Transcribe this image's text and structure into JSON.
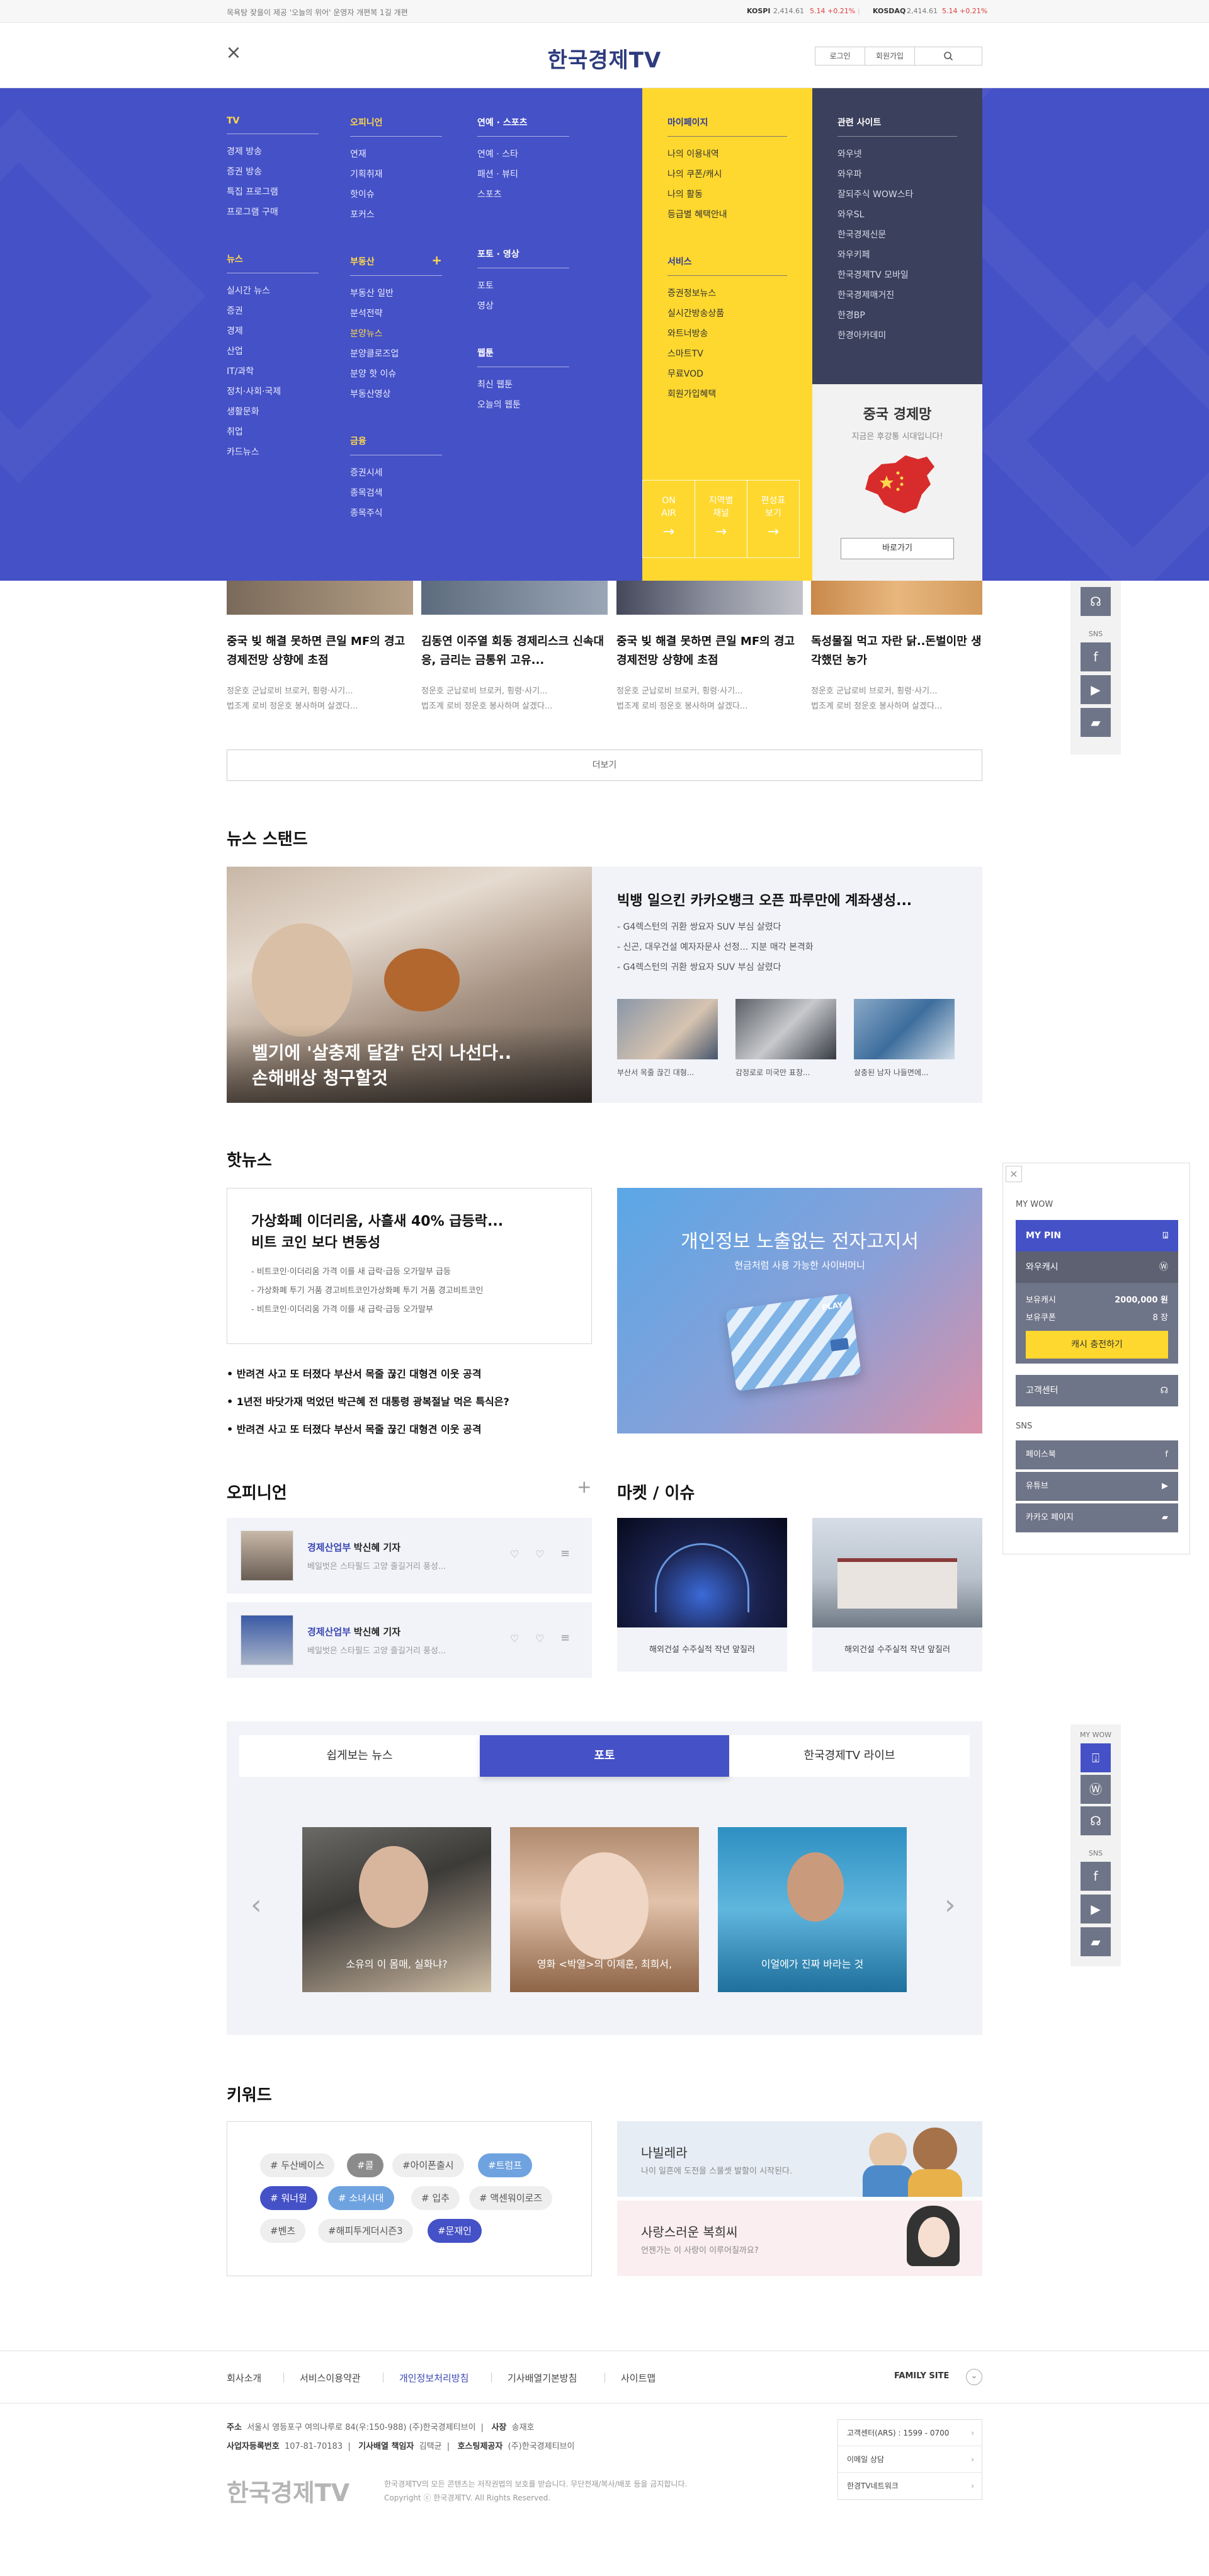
{
  "topbar": {
    "notice": "목욕탕 잦을이 제공 '오늘의 위어' 운영자 개편복 1길 개편",
    "kospi_label": "KOSPI",
    "kospi_value": "2,414.61",
    "kospi_change": "5.14 +0.21%",
    "kosdaq_label": "KOSDAQ",
    "kosdaq_value": "2,414.61",
    "kosdaq_change": "5.14 +0.21%"
  },
  "header": {
    "logo": "한국경제TV",
    "login": "로그인",
    "signup": "회원가입",
    "close_icon": "close-icon",
    "search_icon": "search-icon"
  },
  "menu": {
    "tv": {
      "title": "TV",
      "items": [
        "경제 방송",
        "증권 방송",
        "특집 프로그램",
        "프로그램 구매"
      ]
    },
    "news": {
      "title": "뉴스",
      "items": [
        "실시간 뉴스",
        "증권",
        "경제",
        "산업",
        "IT/과학",
        "정치·사회·국제",
        "생활문화",
        "취업",
        "카드뉴스"
      ]
    },
    "opinion": {
      "title": "오피니언",
      "items": [
        "연재",
        "기획취재",
        "핫이슈",
        "포커스"
      ]
    },
    "realestate": {
      "title": "부동산",
      "plus": "+",
      "items": [
        "부동산 일반",
        "분석전략",
        "분양뉴스",
        "분양클로즈업",
        "분양 핫 이슈",
        "부동산영상"
      ]
    },
    "finance": {
      "title": "금융",
      "items": [
        "증권시세",
        "종목검색",
        "종목주식"
      ]
    },
    "ent": {
      "title": "연예 · 스포츠",
      "items": [
        "연예 · 스타",
        "패션 · 뷰티",
        "스포츠"
      ]
    },
    "photo": {
      "title": "포토 · 영상",
      "items": [
        "포토",
        "영상"
      ]
    },
    "webtoon": {
      "title": "웹툰",
      "items": [
        "최신 웹툰",
        "오늘의 웹툰"
      ]
    },
    "mypage": {
      "title": "마이페이지",
      "items": [
        "나의 이용내역",
        "나의 쿠폰/캐시",
        "나의 활동",
        "등급별 혜택안내"
      ]
    },
    "service": {
      "title": "서비스",
      "items": [
        "증권정보뉴스",
        "실시간방송상품",
        "와트너방송",
        "스마트TV",
        "무료VOD",
        "회원가입혜택"
      ]
    },
    "related": {
      "title": "관련 사이트",
      "items": [
        "와우넷",
        "와우파",
        "잘되주식 WOW스타",
        "와우SL",
        "한국경제신문",
        "와우키페",
        "한국경제TV 모바일",
        "한국경제매거진",
        "한경BP",
        "한경아카데미"
      ]
    },
    "china": {
      "title": "중국 경제망",
      "subtitle": "지금은 후강통 시대입니다!",
      "button": "바로가기"
    },
    "quick": [
      {
        "label": "ON\nAIR"
      },
      {
        "label": "지역별\n채널"
      },
      {
        "label": "편성표\n보기"
      }
    ]
  },
  "topCards": [
    {
      "title": "중국 빚 해결 못하면 큰일 MF의 경고 경제전망 상향에 초점",
      "desc": "정운호 군납로비 브로커, 횡령·사기...\n법조계 로비 정운호 봉사하며 살겠다..."
    },
    {
      "title": "김동연 이주열 회동 경제리스크 신속대응, 금리는 금통위 고유...",
      "desc": "정운호 군납로비 브로커, 횡령·사기...\n법조계 로비 정운호 봉사하며 살겠다..."
    },
    {
      "title": "중국 빚 해결 못하면 큰일 MF의 경고 경제전망 상향에 초점",
      "desc": "정운호 군납로비 브로커, 횡령·사기...\n법조계 로비 정운호 봉사하며 살겠다..."
    },
    {
      "title": "독성물질 먹고 자란 닭..돈벌이만 생각했던 농가",
      "desc": "정운호 군납로비 브로커, 횡령·사기...\n법조계 로비 정운호 봉사하며 살겠다..."
    }
  ],
  "more": "더보기",
  "newsStand": {
    "title": "뉴스 스탠드",
    "mainCaption1": "벨기에 '살충제 달걀' 단지 나선다..",
    "mainCaption2": "손해배상 청구할것",
    "headline": "빅뱅 일으킨 카카오뱅크 오픈 파루만에 계좌생성...",
    "bullets": [
      "- G4렉스턴의 귀환 쌍요자 SUV 부심 살렸다",
      "- 신곤, 대우건설 예자자문사 선정... 지분 매각 본격화",
      "- G4렉스턴의 귀환 쌍요자 SUV 부심 살렸다"
    ],
    "thumbs": [
      "부산서 목줄 끊긴 대형...",
      "감정로로 미국만 표창...",
      "살충된 남자 나들면에..."
    ]
  },
  "hotNews": {
    "title": "핫뉴스",
    "boxTitle1": "가상화폐 이더리움, 사흘새 40% 급등락...",
    "boxTitle2": "비트 코인 보다 변동성",
    "bullets": [
      "- 비트코인·이더리움 가격 이를 새 급락·급등 오가말부 급등",
      "- 가상화폐 투기 거품 경고비트코인가상화폐 투기 거품 경고비트코인",
      "- 비트코인·이더리움 가격 이를 새 급락·급등 오가말부"
    ],
    "list": [
      "반려견 사고 또 터졌다  부산서 목줄 끊긴 대형견 이웃 공격",
      "1년전 바닷가재 먹었던 박근혜 전 대통령 광복절날 먹은 특식은?",
      "반려견 사고 또 터졌다  부산서 목줄 끊긴 대형견 이웃 공격"
    ],
    "adTitle": "개인정보 노출없는 전자고지서",
    "adSub": "현금처럼 사용 가능한 사이버머니",
    "cardLabel": "PLAY"
  },
  "opinion": {
    "title": "오피니언",
    "plus": "+",
    "rows": [
      {
        "dept": "경제산업부",
        "name": "박신혜 기자",
        "desc": "베일벗은 스타필드 고양 줄길거리 풍성..."
      },
      {
        "dept": "경제산업부",
        "name": "박신혜 기자",
        "desc": "베일벗은 스타필드 고양 줄길거리 풍성..."
      }
    ]
  },
  "market": {
    "title": "마켓 / 이슈",
    "items": [
      "해외건설 수주실적 작년 앞질러",
      "해외건설 수주실적 작년 앞질러"
    ]
  },
  "photoSec": {
    "tabs": [
      "쉽게보는 뉴스",
      "포토",
      "한국경제TV 라이브"
    ],
    "captions": [
      "소유의 이 몸매, 실화냐?",
      "영화 <박열>의 이제훈, 최희서,",
      "이얼에가 진짜 바라는 것"
    ]
  },
  "keywords": {
    "title": "키워드",
    "tags": [
      "# 두산베이스",
      "#콜",
      "#아이폰출시",
      "#트럼프",
      "# 워너원",
      "# 소녀시대",
      "# 입추",
      "# 액센워이로즈",
      "#벤츠",
      "#해피투게더시즌3",
      "#문재인"
    ],
    "webtoon1_title": "나빌레라",
    "webtoon1_sub": "나이 일흔에 도전을 스물셋 발할이 시작된다.",
    "webtoon2_title": "사랑스러운 복희씨",
    "webtoon2_sub": "언젠가는 이 사랑이 이루어질까요?"
  },
  "footer": {
    "links": [
      "회사소개",
      "서비스이용약관",
      "개인정보처리방침",
      "기사배열기본방침",
      "사이트맵"
    ],
    "family": "FAMILY SITE",
    "addr_label": "주소",
    "addr": "서울시 영등포구 여의나루로 84(우:150-988) (주)한국경제티브이",
    "ceo_label": "사장",
    "ceo": "송재호",
    "biz_label": "사업자등록번호",
    "biz": "107-81-70183",
    "editor_label": "기사배열 책임자",
    "editor": "김택균",
    "host_label": "호스팅제공자",
    "host": "(주)한국경제티브이",
    "logo": "한국경제TV",
    "copy1": "한국경제TV의 모든 콘텐츠는 저작권법의 보호를 받습니다. 무단전재/복사/배포 등을 금지합니다.",
    "copy2": "Copyright ⓒ 한국경제TV. All Rights Reserved.",
    "cs": [
      "고객센터(ARS) : 1599 - 0700",
      "이메일 상담",
      "한경TV네트워크"
    ]
  },
  "mywow": {
    "title": "MY WOW",
    "pin": "MY PIN",
    "cash": "와우캐시",
    "hold_cash_label": "보유캐시",
    "hold_cash": "2000,000 원",
    "hold_coupon_label": "보유쿠폰",
    "hold_coupon": "8 장",
    "charge": "캐시 충전하기",
    "cs": "고객센터",
    "sns": "SNS",
    "facebook": "페이스북",
    "youtube": "유튜브",
    "kakao": "카카오 페이지"
  },
  "sidebar": {
    "mywow": "MY WOW",
    "sns": "SNS"
  }
}
